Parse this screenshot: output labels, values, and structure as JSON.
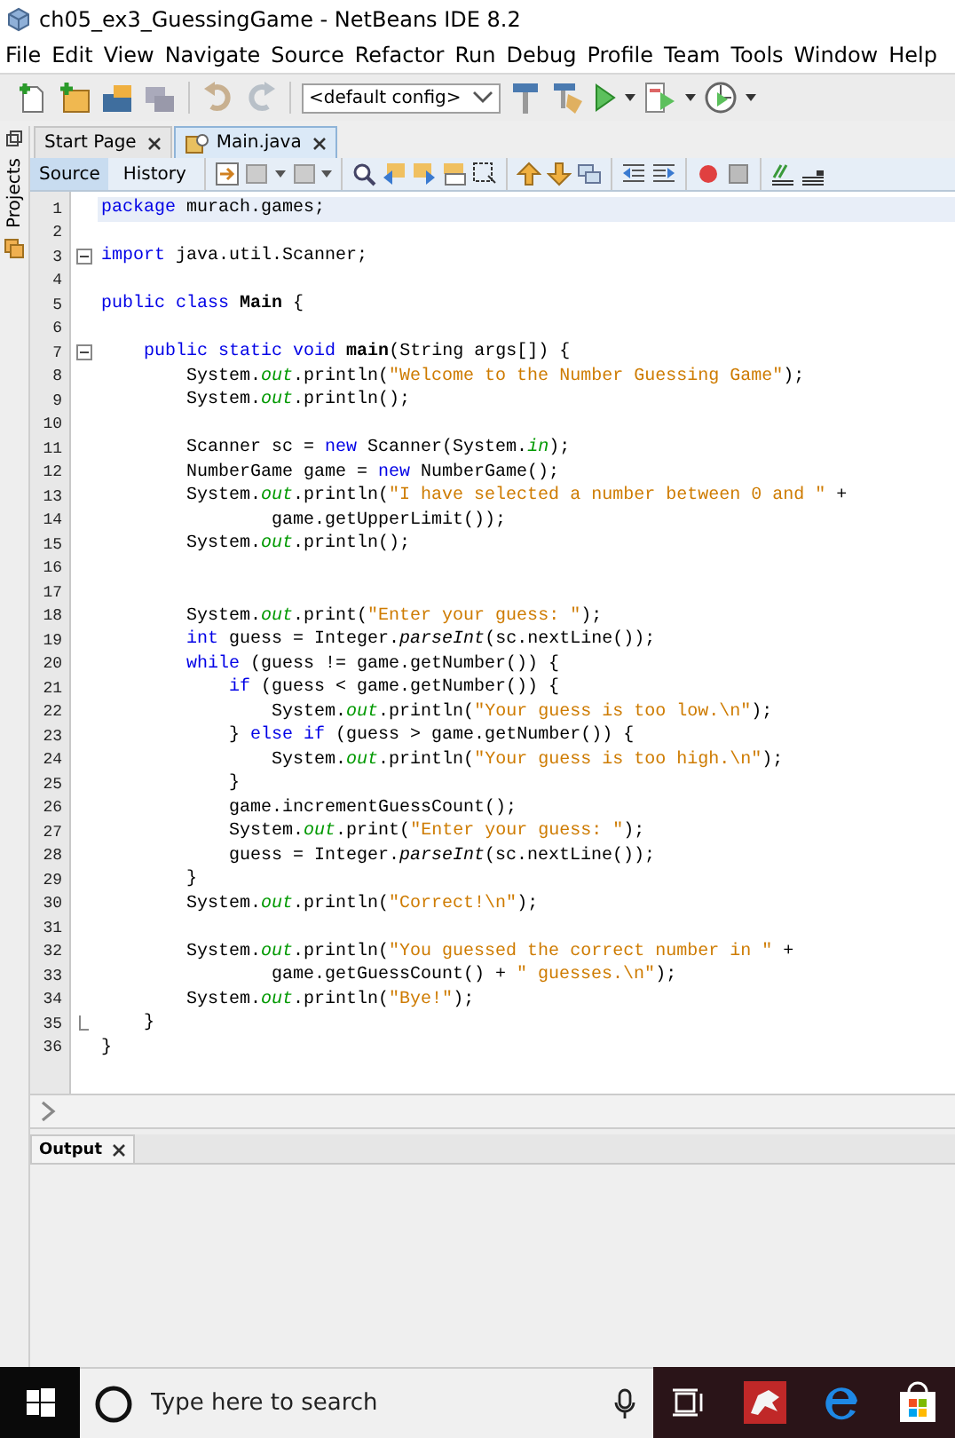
{
  "window": {
    "title": "ch05_ex3_GuessingGame - NetBeans IDE 8.2"
  },
  "menu": [
    "File",
    "Edit",
    "View",
    "Navigate",
    "Source",
    "Refactor",
    "Run",
    "Debug",
    "Profile",
    "Team",
    "Tools",
    "Window",
    "Help"
  ],
  "toolbar": {
    "config": "<default config>"
  },
  "side_panel": {
    "label": "Projects"
  },
  "tabs": [
    {
      "label": "Start Page",
      "selected": false
    },
    {
      "label": "Main.java",
      "selected": true
    }
  ],
  "editor_modes": [
    {
      "label": "Source",
      "selected": true
    },
    {
      "label": "History",
      "selected": false
    }
  ],
  "code_lines": [
    {
      "number": "1",
      "current": true,
      "fold_start": false,
      "fold_end": false,
      "tokens": [
        {
          "kind": "keyword",
          "text": "package"
        },
        {
          "kind": "plain",
          "text": " murach.games;"
        }
      ]
    },
    {
      "number": "2",
      "current": false,
      "fold_start": false,
      "fold_end": false
    },
    {
      "number": "3",
      "current": false,
      "fold_start": true,
      "fold_end": false,
      "tokens": [
        {
          "kind": "keyword",
          "text": "import"
        },
        {
          "kind": "plain",
          "text": " java.util.Scanner;"
        }
      ]
    },
    {
      "number": "4",
      "current": false,
      "fold_start": false,
      "fold_end": false
    },
    {
      "number": "5",
      "current": false,
      "fold_start": false,
      "fold_end": false,
      "tokens": [
        {
          "kind": "keyword",
          "text": "public"
        },
        {
          "kind": "keyword",
          "text": " class"
        },
        {
          "kind": "bold",
          "text": " Main"
        },
        {
          "kind": "plain",
          "text": " {"
        }
      ]
    },
    {
      "number": "6",
      "current": false,
      "fold_start": false,
      "fold_end": false
    },
    {
      "number": "7",
      "current": false,
      "fold_start": true,
      "fold_end": false,
      "tokens": [
        {
          "kind": "keyword",
          "text": "    public"
        },
        {
          "kind": "keyword",
          "text": " static"
        },
        {
          "kind": "keyword",
          "text": " void"
        },
        {
          "kind": "bold",
          "text": " main"
        },
        {
          "kind": "plain",
          "text": "(String args[]) {"
        }
      ]
    },
    {
      "number": "8",
      "current": false,
      "fold_start": false,
      "fold_end": false,
      "tokens": [
        {
          "kind": "plain",
          "text": "        System."
        },
        {
          "kind": "field",
          "text": "out"
        },
        {
          "kind": "plain",
          "text": ".println("
        },
        {
          "kind": "string",
          "text": "\"Welcome to the Number Guessing Game\""
        },
        {
          "kind": "plain",
          "text": ");"
        }
      ]
    },
    {
      "number": "9",
      "current": false,
      "fold_start": false,
      "fold_end": false,
      "tokens": [
        {
          "kind": "plain",
          "text": "        System."
        },
        {
          "kind": "field",
          "text": "out"
        },
        {
          "kind": "plain",
          "text": ".println();"
        }
      ]
    },
    {
      "number": "10",
      "current": false,
      "fold_start": false,
      "fold_end": false
    },
    {
      "number": "11",
      "current": false,
      "fold_start": false,
      "fold_end": false,
      "tokens": [
        {
          "kind": "plain",
          "text": "        Scanner sc = "
        },
        {
          "kind": "keyword",
          "text": "new"
        },
        {
          "kind": "plain",
          "text": " Scanner(System."
        },
        {
          "kind": "field",
          "text": "in"
        },
        {
          "kind": "plain",
          "text": ");"
        }
      ]
    },
    {
      "number": "12",
      "current": false,
      "fold_start": false,
      "fold_end": false,
      "tokens": [
        {
          "kind": "plain",
          "text": "        NumberGame game = "
        },
        {
          "kind": "keyword",
          "text": "new"
        },
        {
          "kind": "plain",
          "text": " NumberGame();"
        }
      ]
    },
    {
      "number": "13",
      "current": false,
      "fold_start": false,
      "fold_end": false,
      "tokens": [
        {
          "kind": "plain",
          "text": "        System."
        },
        {
          "kind": "field",
          "text": "out"
        },
        {
          "kind": "plain",
          "text": ".println("
        },
        {
          "kind": "string",
          "text": "\"I have selected a number between 0 and \""
        },
        {
          "kind": "plain",
          "text": " +"
        }
      ]
    },
    {
      "number": "14",
      "current": false,
      "fold_start": false,
      "fold_end": false,
      "tokens": [
        {
          "kind": "plain",
          "text": "                game.getUpperLimit());"
        }
      ]
    },
    {
      "number": "15",
      "current": false,
      "fold_start": false,
      "fold_end": false,
      "tokens": [
        {
          "kind": "plain",
          "text": "        System."
        },
        {
          "kind": "field",
          "text": "out"
        },
        {
          "kind": "plain",
          "text": ".println();"
        }
      ]
    },
    {
      "number": "16",
      "current": false,
      "fold_start": false,
      "fold_end": false
    },
    {
      "number": "17",
      "current": false,
      "fold_start": false,
      "fold_end": false
    },
    {
      "number": "18",
      "current": false,
      "fold_start": false,
      "fold_end": false,
      "tokens": [
        {
          "kind": "plain",
          "text": "        System."
        },
        {
          "kind": "field",
          "text": "out"
        },
        {
          "kind": "plain",
          "text": ".print("
        },
        {
          "kind": "string",
          "text": "\"Enter your guess: \""
        },
        {
          "kind": "plain",
          "text": ");"
        }
      ]
    },
    {
      "number": "19",
      "current": false,
      "fold_start": false,
      "fold_end": false,
      "tokens": [
        {
          "kind": "keyword",
          "text": "        int"
        },
        {
          "kind": "plain",
          "text": " guess = Integer."
        },
        {
          "kind": "italic",
          "text": "parseInt"
        },
        {
          "kind": "plain",
          "text": "(sc.nextLine());"
        }
      ]
    },
    {
      "number": "20",
      "current": false,
      "fold_start": false,
      "fold_end": false,
      "tokens": [
        {
          "kind": "keyword",
          "text": "        while"
        },
        {
          "kind": "plain",
          "text": " (guess != game.getNumber()) {"
        }
      ]
    },
    {
      "number": "21",
      "current": false,
      "fold_start": false,
      "fold_end": false,
      "tokens": [
        {
          "kind": "keyword",
          "text": "            if"
        },
        {
          "kind": "plain",
          "text": " (guess < game.getNumber()) {"
        }
      ]
    },
    {
      "number": "22",
      "current": false,
      "fold_start": false,
      "fold_end": false,
      "tokens": [
        {
          "kind": "plain",
          "text": "                System."
        },
        {
          "kind": "field",
          "text": "out"
        },
        {
          "kind": "plain",
          "text": ".println("
        },
        {
          "kind": "string",
          "text": "\"Your guess is too low.\\n\""
        },
        {
          "kind": "plain",
          "text": ");"
        }
      ]
    },
    {
      "number": "23",
      "current": false,
      "fold_start": false,
      "fold_end": false,
      "tokens": [
        {
          "kind": "plain",
          "text": "            } "
        },
        {
          "kind": "keyword",
          "text": "else"
        },
        {
          "kind": "keyword",
          "text": " if"
        },
        {
          "kind": "plain",
          "text": " (guess > game.getNumber()) {"
        }
      ]
    },
    {
      "number": "24",
      "current": false,
      "fold_start": false,
      "fold_end": false,
      "tokens": [
        {
          "kind": "plain",
          "text": "                System."
        },
        {
          "kind": "field",
          "text": "out"
        },
        {
          "kind": "plain",
          "text": ".println("
        },
        {
          "kind": "string",
          "text": "\"Your guess is too high.\\n\""
        },
        {
          "kind": "plain",
          "text": ");"
        }
      ]
    },
    {
      "number": "25",
      "current": false,
      "fold_start": false,
      "fold_end": false,
      "tokens": [
        {
          "kind": "plain",
          "text": "            }"
        }
      ]
    },
    {
      "number": "26",
      "current": false,
      "fold_start": false,
      "fold_end": false,
      "tokens": [
        {
          "kind": "plain",
          "text": "            game.incrementGuessCount();"
        }
      ]
    },
    {
      "number": "27",
      "current": false,
      "fold_start": false,
      "fold_end": false,
      "tokens": [
        {
          "kind": "plain",
          "text": "            System."
        },
        {
          "kind": "field",
          "text": "out"
        },
        {
          "kind": "plain",
          "text": ".print("
        },
        {
          "kind": "string",
          "text": "\"Enter your guess: \""
        },
        {
          "kind": "plain",
          "text": ");"
        }
      ]
    },
    {
      "number": "28",
      "current": false,
      "fold_start": false,
      "fold_end": false,
      "tokens": [
        {
          "kind": "plain",
          "text": "            guess = Integer."
        },
        {
          "kind": "italic",
          "text": "parseInt"
        },
        {
          "kind": "plain",
          "text": "(sc.nextLine());"
        }
      ]
    },
    {
      "number": "29",
      "current": false,
      "fold_start": false,
      "fold_end": false,
      "tokens": [
        {
          "kind": "plain",
          "text": "        }"
        }
      ]
    },
    {
      "number": "30",
      "current": false,
      "fold_start": false,
      "fold_end": false,
      "tokens": [
        {
          "kind": "plain",
          "text": "        System."
        },
        {
          "kind": "field",
          "text": "out"
        },
        {
          "kind": "plain",
          "text": ".println("
        },
        {
          "kind": "string",
          "text": "\"Correct!\\n\""
        },
        {
          "kind": "plain",
          "text": ");"
        }
      ]
    },
    {
      "number": "31",
      "current": false,
      "fold_start": false,
      "fold_end": false
    },
    {
      "number": "32",
      "current": false,
      "fold_start": false,
      "fold_end": false,
      "tokens": [
        {
          "kind": "plain",
          "text": "        System."
        },
        {
          "kind": "field",
          "text": "out"
        },
        {
          "kind": "plain",
          "text": ".println("
        },
        {
          "kind": "string",
          "text": "\"You guessed the correct number in \""
        },
        {
          "kind": "plain",
          "text": " +"
        }
      ]
    },
    {
      "number": "33",
      "current": false,
      "fold_start": false,
      "fold_end": false,
      "tokens": [
        {
          "kind": "plain",
          "text": "                game.getGuessCount() + "
        },
        {
          "kind": "string",
          "text": "\" guesses.\\n\""
        },
        {
          "kind": "plain",
          "text": ");"
        }
      ]
    },
    {
      "number": "34",
      "current": false,
      "fold_start": false,
      "fold_end": false,
      "tokens": [
        {
          "kind": "plain",
          "text": "        System."
        },
        {
          "kind": "field",
          "text": "out"
        },
        {
          "kind": "plain",
          "text": ".println("
        },
        {
          "kind": "string",
          "text": "\"Bye!\""
        },
        {
          "kind": "plain",
          "text": ");"
        }
      ]
    },
    {
      "number": "35",
      "current": false,
      "fold_start": false,
      "fold_end": true,
      "tokens": [
        {
          "kind": "plain",
          "text": "    }"
        }
      ]
    },
    {
      "number": "36",
      "current": false,
      "fold_start": false,
      "fold_end": false,
      "tokens": [
        {
          "kind": "plain",
          "text": "}"
        }
      ]
    }
  ],
  "output_panel": {
    "title": "Output"
  },
  "taskbar": {
    "search_placeholder": "Type here to search"
  }
}
